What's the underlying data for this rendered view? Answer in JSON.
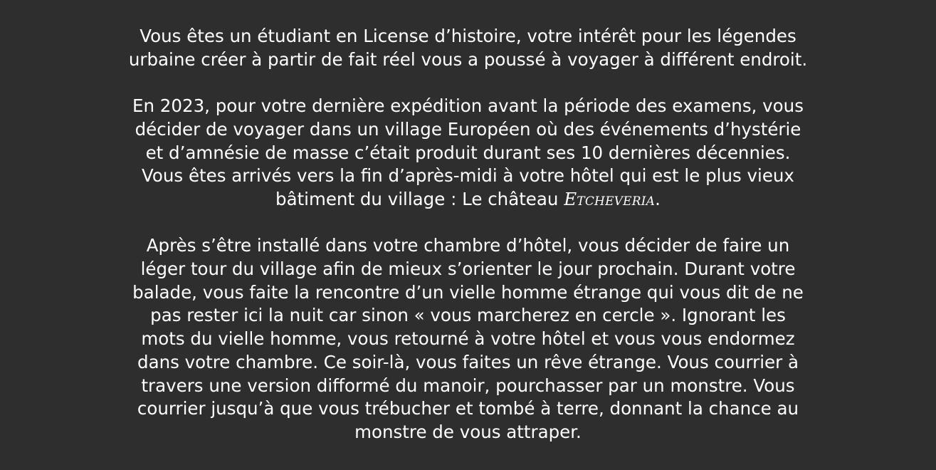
{
  "story": {
    "p1": [
      "Vous êtes un étudiant en License d’histoire, votre intérêt pour les légendes",
      "urbaine créer à partir de fait réel vous a poussé à voyager à différent endroit."
    ],
    "p2": [
      "En 2023, pour votre dernière expédition avant la période des examens, vous",
      "décider de voyager dans un village Européen où des événements d’hystérie",
      "et d’amnésie de masse c’était produit durant ses 10 dernières décennies.",
      "Vous êtes arrivés vers la fin d’après-midi à votre hôtel qui est le plus vieux"
    ],
    "p2_last_prefix": "bâtiment du village : Le château ",
    "place_name": "Etcheveria",
    "p2_last_suffix": ".",
    "p3": [
      "Après s’être installé dans votre chambre d’hôtel, vous décider de faire un",
      "léger tour du village afin de mieux s’orienter le jour prochain. Durant votre",
      "balade, vous faite la rencontre d’un vielle homme étrange qui vous dit de ne",
      "pas rester ici la nuit car sinon « vous marcherez en cercle ». Ignorant les",
      "mots du vielle homme, vous retourné à votre hôtel et vous vous endormez",
      "dans votre chambre. Ce soir-là, vous faites un rêve étrange. Vous courrier à",
      "travers une version difformé du manoir, pourchasser par un monstre. Vous",
      "courrier jusqu’à que vous trébucher et tombé à terre, donnant la chance au",
      "monstre de vous attraper."
    ]
  }
}
